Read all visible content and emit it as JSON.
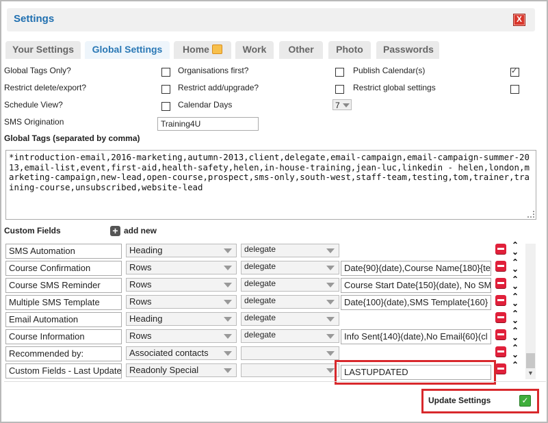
{
  "window": {
    "title": "Settings",
    "close_label": "X"
  },
  "tabs": [
    {
      "label": "Your Settings"
    },
    {
      "label": "Global Settings"
    },
    {
      "label": "Home"
    },
    {
      "label": "Work"
    },
    {
      "label": "Other"
    },
    {
      "label": "Photo"
    },
    {
      "label": "Passwords"
    }
  ],
  "options": {
    "global_tags_only": {
      "label": "Global Tags Only?",
      "checked": false
    },
    "restrict_delete_export": {
      "label": "Restrict delete/export?",
      "checked": false
    },
    "schedule_view": {
      "label": "Schedule View?",
      "checked": false
    },
    "organisations_first": {
      "label": "Organisations first?",
      "checked": false
    },
    "restrict_add_upgrade": {
      "label": "Restrict add/upgrade?",
      "checked": false
    },
    "calendar_days": {
      "label": "Calendar Days",
      "value": "7"
    },
    "publish_calendars": {
      "label": "Publish Calendar(s)",
      "checked": true
    },
    "restrict_global_settings": {
      "label": "Restrict global settings",
      "checked": false
    },
    "sms_origination": {
      "label": "SMS Origination",
      "value": "Training4U"
    }
  },
  "global_tags": {
    "label": "Global Tags (separated by comma)",
    "value": "*introduction-email,2016-marketing,autumn-2013,client,delegate,email-campaign,email-campaign-summer-2013,email-list,event,first-aid,health-safety,helen,in-house-training,jean-luc,linkedin - helen,london,marketing-campaign,new-lead,open-course,prospect,sms-only,south-west,staff-team,testing,tom,trainer,training-course,unsubscribed,website-lead"
  },
  "custom_fields": {
    "label": "Custom Fields",
    "add_new_label": "add new",
    "rows": [
      {
        "name": "SMS Automation",
        "type": "Heading",
        "assoc": "delegate",
        "extra": null
      },
      {
        "name": "Course Confirmation",
        "type": "Rows",
        "assoc": "delegate",
        "extra": "Date{90}(date),Course Name{180}{te"
      },
      {
        "name": "Course SMS Reminder",
        "type": "Rows",
        "assoc": "delegate",
        "extra": "Course Start Date{150}(date), No SM"
      },
      {
        "name": "Multiple SMS Template",
        "type": "Rows",
        "assoc": "delegate",
        "extra": "Date{100}(date),SMS Template{160}"
      },
      {
        "name": "Email Automation",
        "type": "Heading",
        "assoc": "delegate",
        "extra": null
      },
      {
        "name": "Course Information",
        "type": "Rows",
        "assoc": "delegate",
        "extra": "Info Sent{140}(date),No Email{60}(cl"
      },
      {
        "name": "Recommended by:",
        "type": "Associated contacts",
        "assoc": "",
        "extra": ""
      },
      {
        "name": "Custom Fields - Last Updated",
        "type": "Readonly Special",
        "assoc": "",
        "extra": "LASTUPDATED"
      }
    ]
  },
  "footer": {
    "update_label": "Update Settings"
  },
  "colors": {
    "highlight": "#d8282c",
    "title": "#1f6fb0",
    "active_tab": "#2a78b5"
  }
}
